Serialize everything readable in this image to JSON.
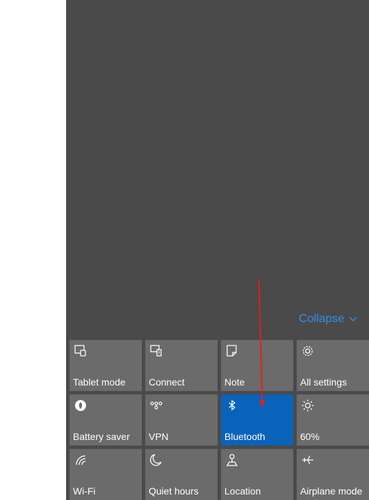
{
  "action_center": {
    "collapse_label": "Collapse",
    "tiles": [
      {
        "label": "Tablet mode",
        "icon": "tablet-mode-icon",
        "active": false
      },
      {
        "label": "Connect",
        "icon": "connect-icon",
        "active": false
      },
      {
        "label": "Note",
        "icon": "note-icon",
        "active": false
      },
      {
        "label": "All settings",
        "icon": "gear-icon",
        "active": false
      },
      {
        "label": "Battery saver",
        "icon": "battery-saver-icon",
        "active": false
      },
      {
        "label": "VPN",
        "icon": "vpn-icon",
        "active": false
      },
      {
        "label": "Bluetooth",
        "icon": "bluetooth-icon",
        "active": true
      },
      {
        "label": "60%",
        "icon": "brightness-icon",
        "active": false
      },
      {
        "label": "Wi-Fi",
        "icon": "wifi-icon",
        "active": false
      },
      {
        "label": "Quiet hours",
        "icon": "moon-icon",
        "active": false
      },
      {
        "label": "Location",
        "icon": "location-icon",
        "active": false
      },
      {
        "label": "Airplane mode",
        "icon": "airplane-icon",
        "active": false
      }
    ]
  },
  "colors": {
    "panel_bg": "#4a4a4a",
    "tile_bg": "#6b6b6b",
    "tile_active_bg": "#0a63ba",
    "link_blue": "#2f8fe6",
    "annotation_arrow": "#e0201f"
  }
}
